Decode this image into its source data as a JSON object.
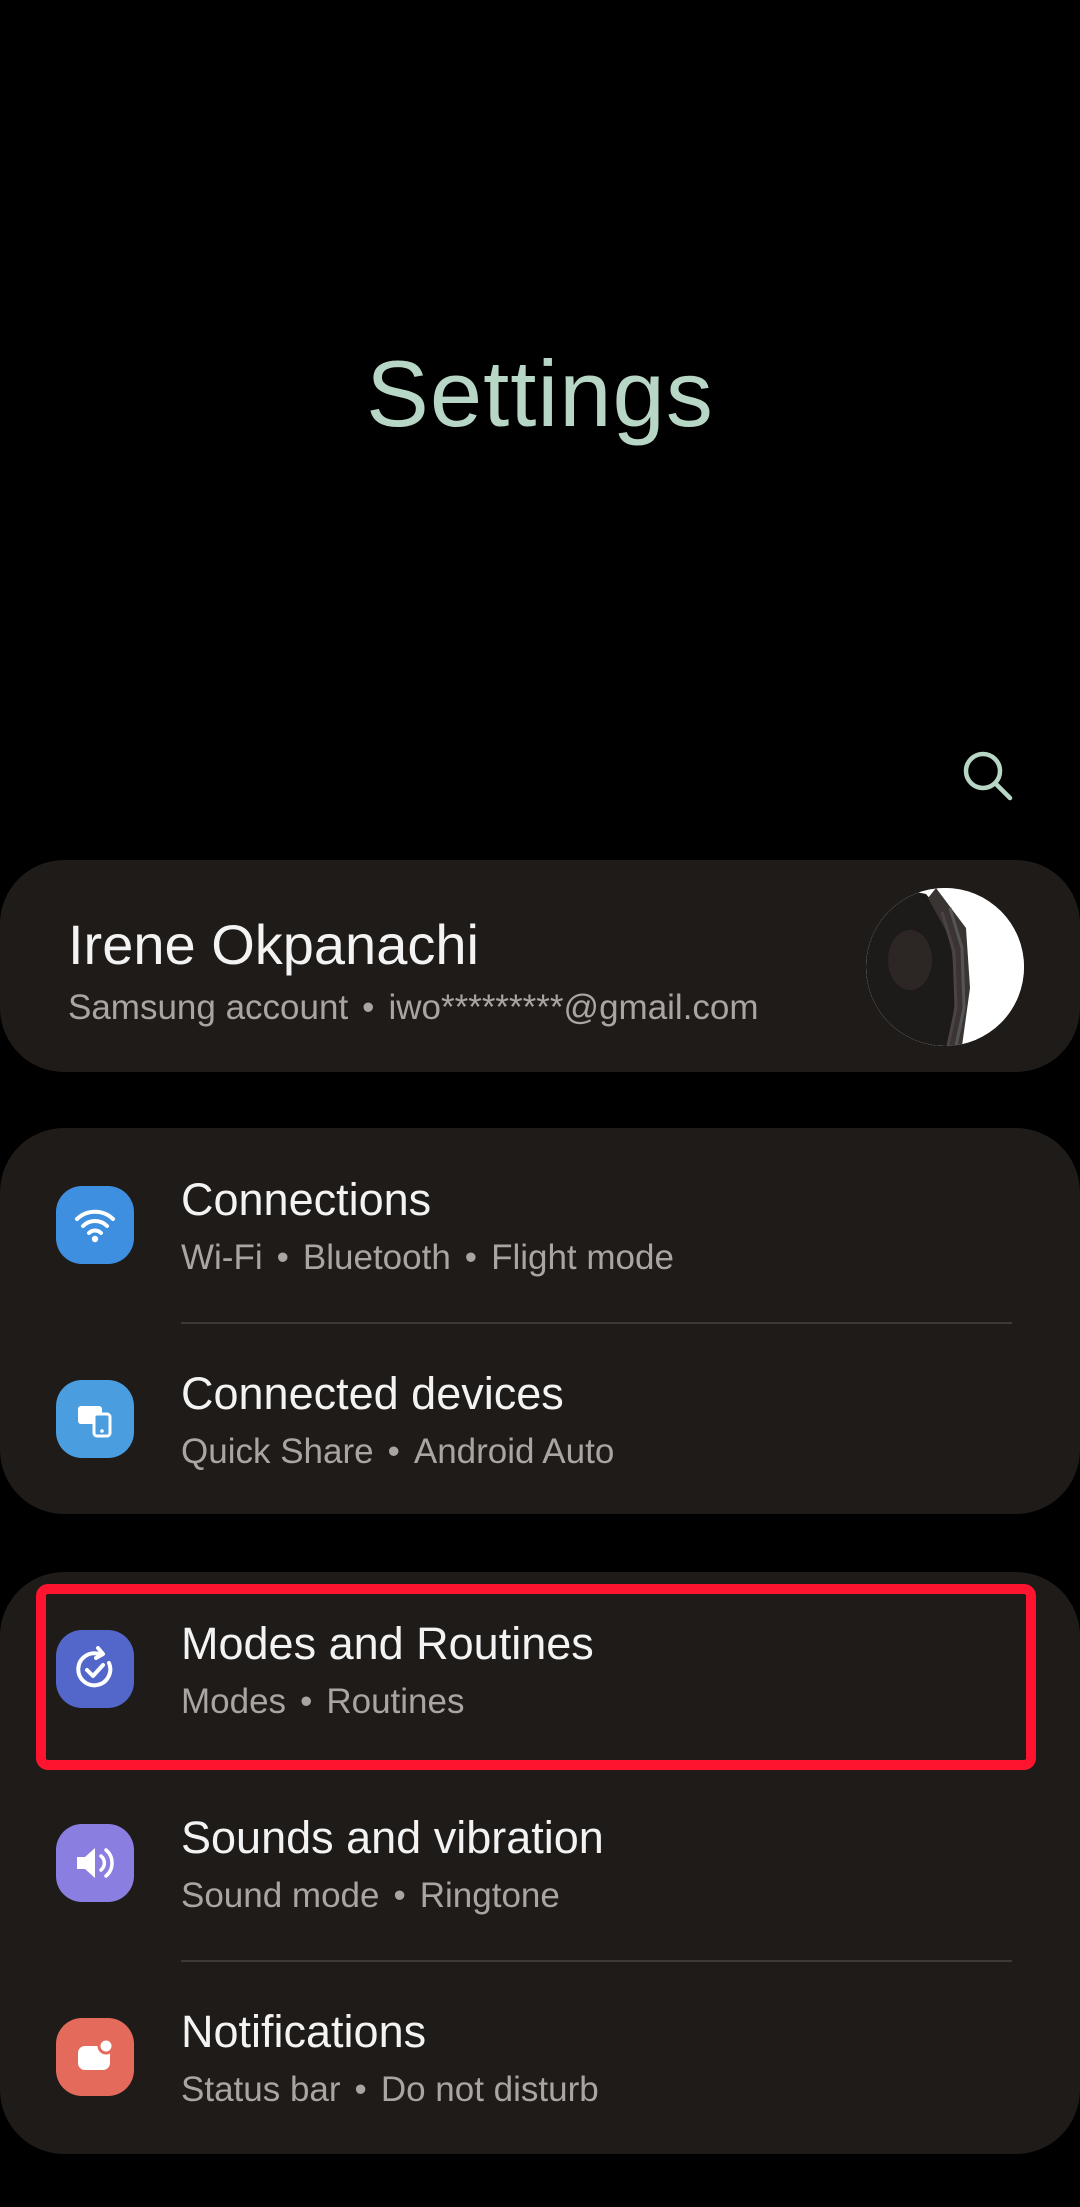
{
  "header": {
    "title": "Settings",
    "search_icon": "search-icon"
  },
  "account": {
    "name": "Irene Okpanachi",
    "type": "Samsung account",
    "email": "iwo*********@gmail.com"
  },
  "groups": [
    {
      "items": [
        {
          "title": "Connections",
          "subtitle": [
            "Wi-Fi",
            "Bluetooth",
            "Flight mode"
          ],
          "icon": "wifi-icon",
          "icon_color": "#3f8fe0"
        },
        {
          "title": "Connected devices",
          "subtitle": [
            "Quick Share",
            "Android Auto"
          ],
          "icon": "connected-devices-icon",
          "icon_color": "#4a9ee0"
        }
      ]
    },
    {
      "items": [
        {
          "title": "Modes and Routines",
          "subtitle": [
            "Modes",
            "Routines"
          ],
          "icon": "routines-check-icon",
          "icon_color": "#5267c9",
          "highlighted": true
        },
        {
          "title": "Sounds and vibration",
          "subtitle": [
            "Sound mode",
            "Ringtone"
          ],
          "icon": "speaker-icon",
          "icon_color": "#8a7ee0"
        },
        {
          "title": "Notifications",
          "subtitle": [
            "Status bar",
            "Do not disturb"
          ],
          "icon": "notification-icon",
          "icon_color": "#e46a5c"
        }
      ]
    }
  ],
  "colors": {
    "background": "#000000",
    "card": "#1e1b18",
    "title": "#b8d6c6",
    "highlight": "#ff1430"
  }
}
